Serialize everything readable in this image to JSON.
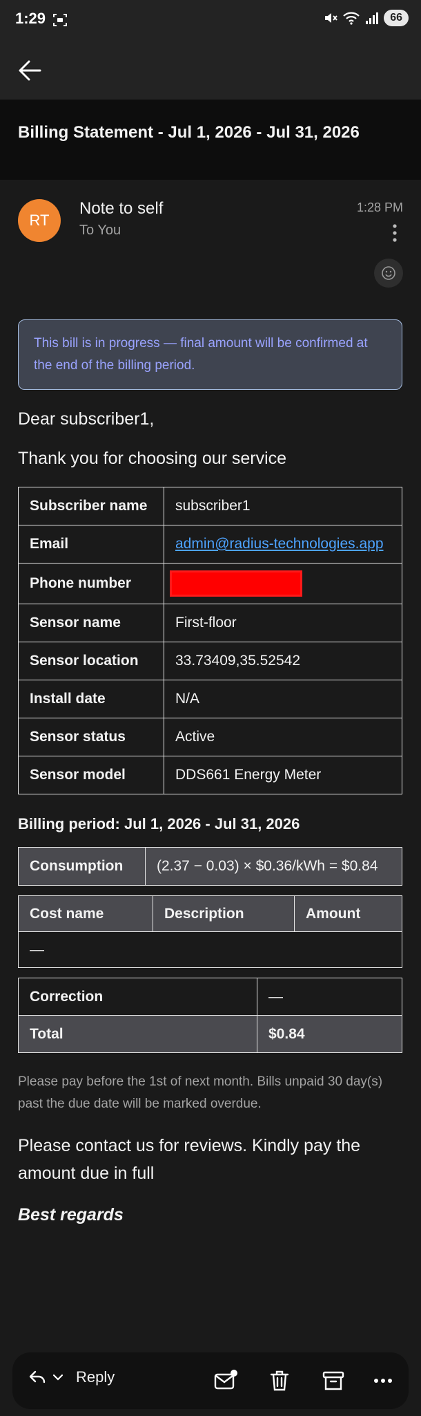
{
  "status_bar": {
    "time": "1:29",
    "battery": "66"
  },
  "email": {
    "subject": "Billing Statement - Jul 1, 2026 - Jul 31, 2026",
    "sender": {
      "initials": "RT",
      "name": "Note to self",
      "to": "To You",
      "time": "1:28 PM"
    },
    "notice": "This bill is in progress — final amount will be confirmed at the end of the billing period.",
    "greeting": "Dear subscriber1,",
    "thanks": "Thank you for choosing our service",
    "info": {
      "subscriber_name_label": "Subscriber name",
      "subscriber_name": "subscriber1",
      "email_label": "Email",
      "email": "admin@radius-technologies.app",
      "phone_label": "Phone number",
      "sensor_name_label": "Sensor name",
      "sensor_name": "First-floor",
      "sensor_location_label": "Sensor location",
      "sensor_location": "33.73409,35.52542",
      "install_date_label": "Install date",
      "install_date": "N/A",
      "sensor_status_label": "Sensor status",
      "sensor_status": "Active",
      "sensor_model_label": "Sensor model",
      "sensor_model": "DDS661 Energy Meter"
    },
    "billing_period": "Billing period: Jul 1, 2026 - Jul 31, 2026",
    "consumption": {
      "label": "Consumption",
      "formula": "(2.37 − 0.03) × $0.36/kWh = $0.84"
    },
    "costs": {
      "headers": [
        "Cost name",
        "Description",
        "Amount"
      ],
      "empty": "—"
    },
    "correction": {
      "label": "Correction",
      "value": "—"
    },
    "total": {
      "label": "Total",
      "value": "$0.84"
    },
    "pay_note": "Please pay before the 1st of next month. Bills unpaid 30 day(s) past the due date will be marked overdue.",
    "contact": "Please contact us for reviews. Kindly pay the amount due in full",
    "regards": "Best regards"
  },
  "bottom_bar": {
    "reply_label": "Reply"
  },
  "colors": {
    "avatar": "#f08530",
    "notice_text": "#9aa3ff",
    "link": "#4da3ff",
    "redaction": "#ff0000"
  },
  "icons": [
    "back-arrow-icon",
    "screenshot-icon",
    "mute-icon",
    "wifi-icon",
    "signal-icon",
    "more-vert-icon",
    "emoji-icon",
    "reply-icon",
    "chevron-down-icon",
    "mark-unread-icon",
    "delete-icon",
    "archive-icon",
    "more-horiz-icon"
  ]
}
